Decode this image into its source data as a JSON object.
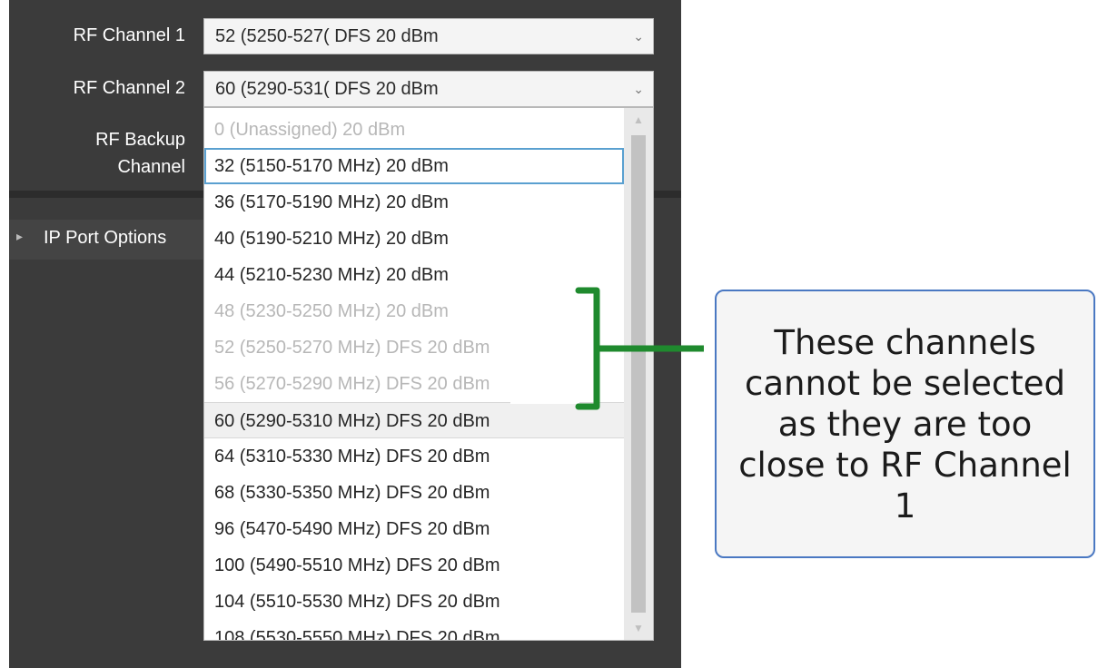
{
  "form": {
    "rf_channel_1": {
      "label": "RF Channel 1",
      "value": "52 (5250-527( DFS 20 dBm"
    },
    "rf_channel_2": {
      "label": "RF Channel 2",
      "value": "60 (5290-531( DFS 20 dBm"
    },
    "rf_backup": {
      "label_line1": "RF Backup",
      "label_line2": "Channel"
    },
    "ip_port_options": {
      "label": "IP Port Options"
    }
  },
  "dropdown": {
    "options": [
      {
        "text": "0 (Unassigned)  20 dBm",
        "state": "disabled"
      },
      {
        "text": "32 (5150-5170 MHz)  20 dBm",
        "state": "focused"
      },
      {
        "text": "36 (5170-5190 MHz)  20 dBm",
        "state": "normal"
      },
      {
        "text": "40 (5190-5210 MHz)  20 dBm",
        "state": "normal"
      },
      {
        "text": "44 (5210-5230 MHz)  20 dBm",
        "state": "normal"
      },
      {
        "text": "48 (5230-5250 MHz)  20 dBm",
        "state": "disabled"
      },
      {
        "text": "52 (5250-5270 MHz) DFS 20 dBm",
        "state": "disabled"
      },
      {
        "text": "56 (5270-5290 MHz) DFS 20 dBm",
        "state": "disabled"
      },
      {
        "text": "60 (5290-5310 MHz) DFS 20 dBm",
        "state": "selected"
      },
      {
        "text": "64 (5310-5330 MHz) DFS 20 dBm",
        "state": "normal"
      },
      {
        "text": "68 (5330-5350 MHz) DFS 20 dBm",
        "state": "normal"
      },
      {
        "text": "96 (5470-5490 MHz) DFS 20 dBm",
        "state": "normal"
      },
      {
        "text": "100 (5490-5510 MHz) DFS 20 dBm",
        "state": "normal"
      },
      {
        "text": "104 (5510-5530 MHz) DFS 20 dBm",
        "state": "normal"
      },
      {
        "text": "108 (5530-5550 MHz) DFS 20 dBm",
        "state": "normal"
      }
    ]
  },
  "callout": {
    "text": "These channels cannot be selected as they are too close to RF Channel 1"
  },
  "colors": {
    "panel": "#3b3b3b",
    "bracket": "#1f8a2e",
    "callout_border": "#4a78c2",
    "disabled_text": "#b7b7b7"
  }
}
